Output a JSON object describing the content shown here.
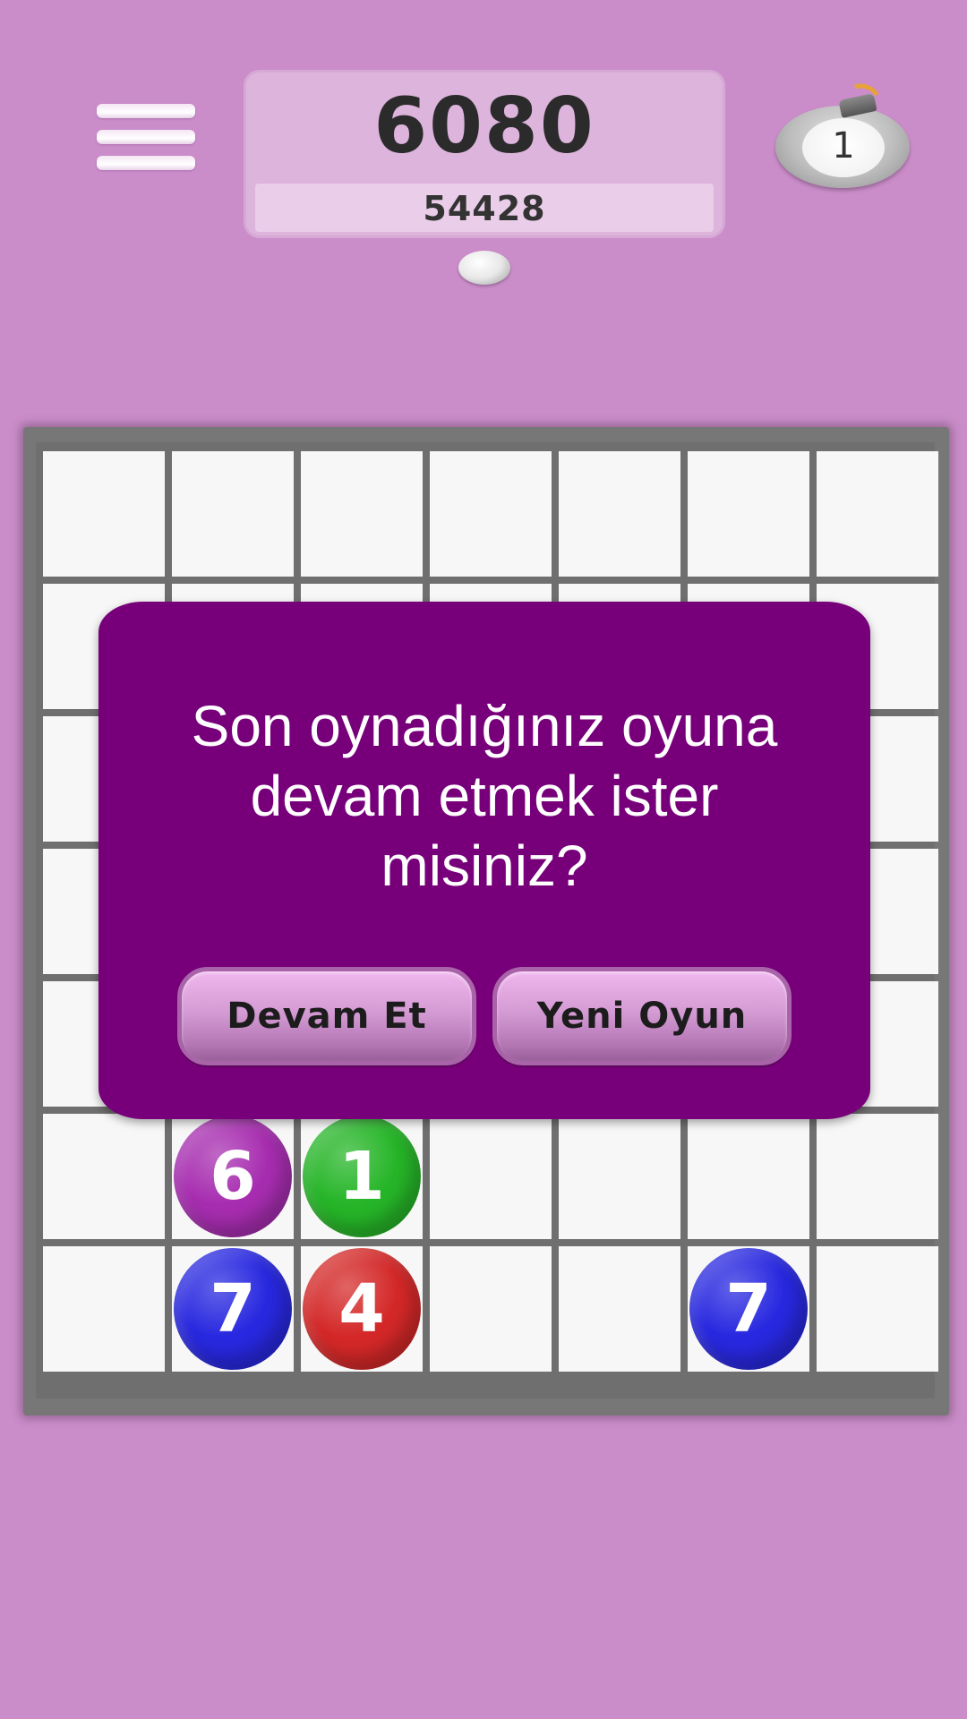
{
  "header": {
    "score": "6080",
    "best_score": "54428",
    "bomb_count": "1"
  },
  "dialog": {
    "message_line1": "Son oynadığınız oyuna",
    "message_line2": "devam etmek ister",
    "message_line3": "misiniz?",
    "continue_label": "Devam Et",
    "new_game_label": "Yeni Oyun"
  },
  "board": {
    "columns": 7,
    "rows": 7,
    "balls": [
      {
        "row": 6,
        "col": 2,
        "value": "6",
        "color": "#a72db0"
      },
      {
        "row": 6,
        "col": 3,
        "value": "1",
        "color": "#26b528"
      },
      {
        "row": 7,
        "col": 2,
        "value": "7",
        "color": "#2828e0"
      },
      {
        "row": 7,
        "col": 3,
        "value": "4",
        "color": "#d42828"
      },
      {
        "row": 7,
        "col": 6,
        "value": "7",
        "color": "#2828e0"
      }
    ]
  },
  "colors": {
    "background": "#cb8dca",
    "dialog": "#77007a",
    "grid_lines": "#6f6f6f",
    "cell": "#f7f7f7"
  }
}
